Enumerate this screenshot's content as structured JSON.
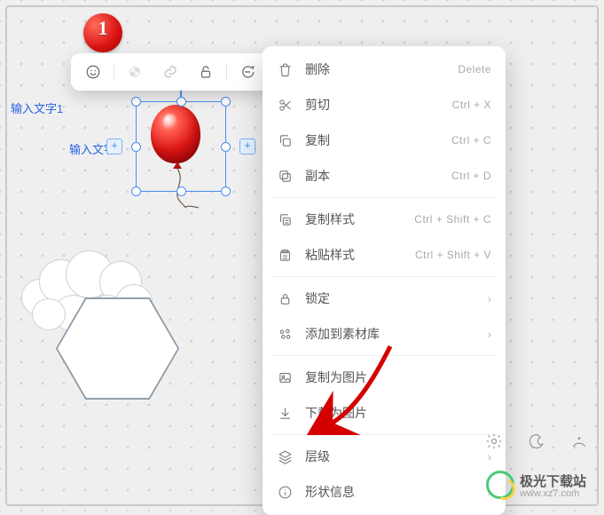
{
  "labels": {
    "text1": "输入文字1",
    "text2": "输入文字1",
    "badge_number": "1"
  },
  "toolbar": {
    "items": [
      "emoji-icon",
      "circle-icon",
      "link-icon",
      "unlock-icon",
      "comment-icon",
      "more-icon"
    ]
  },
  "context_menu": {
    "groups": [
      {
        "items": [
          {
            "icon": "trash-icon",
            "label": "删除",
            "shortcut": "Delete"
          },
          {
            "icon": "scissors-icon",
            "label": "剪切",
            "shortcut": "Ctrl + X"
          },
          {
            "icon": "copy-icon",
            "label": "复制",
            "shortcut": "Ctrl + C"
          },
          {
            "icon": "duplicate-icon",
            "label": "副本",
            "shortcut": "Ctrl + D"
          }
        ]
      },
      {
        "items": [
          {
            "icon": "copy-style-icon",
            "label": "复制样式",
            "shortcut": "Ctrl + Shift + C"
          },
          {
            "icon": "paste-style-icon",
            "label": "粘贴样式",
            "shortcut": "Ctrl + Shift + V"
          }
        ]
      },
      {
        "items": [
          {
            "icon": "lock-icon",
            "label": "锁定",
            "submenu": true
          },
          {
            "icon": "palette-icon",
            "label": "添加到素材库",
            "submenu": true
          }
        ]
      },
      {
        "items": [
          {
            "icon": "image-icon",
            "label": "复制为图片"
          },
          {
            "icon": "download-icon",
            "label": "下载为图片"
          }
        ]
      },
      {
        "items": [
          {
            "icon": "layers-icon",
            "label": "层级",
            "submenu": true
          },
          {
            "icon": "info-icon",
            "label": "形状信息",
            "submenu": true
          }
        ]
      }
    ]
  },
  "watermark": {
    "title": "极光下载站",
    "url": "www.xz7.com"
  },
  "colors": {
    "accent": "#4a8ef0",
    "danger": "#d81212",
    "menu_text": "#555",
    "shortcut": "#aaa"
  }
}
